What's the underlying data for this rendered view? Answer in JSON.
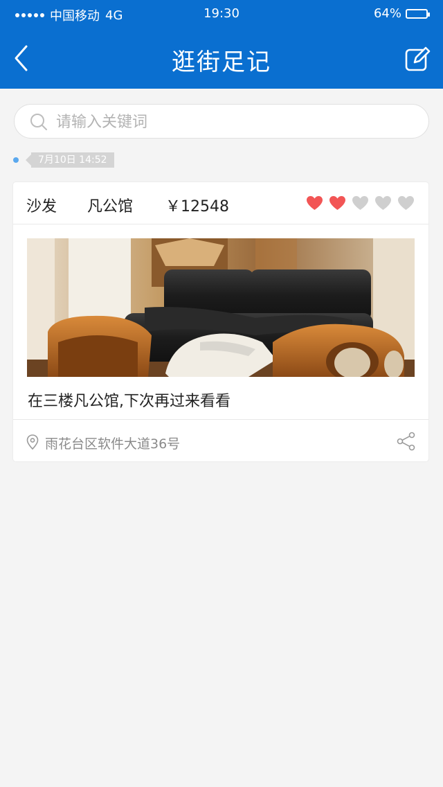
{
  "status_bar": {
    "carrier": "中国移动",
    "network": "4G",
    "time": "19:30",
    "battery": "64%",
    "battery_level": 0.64
  },
  "nav": {
    "title": "逛街足记",
    "back_icon": "chevron-left-icon",
    "edit_icon": "edit-icon"
  },
  "search": {
    "placeholder": "请输入关键词",
    "value": ""
  },
  "timeline": {
    "date": "7月10日  14:52"
  },
  "entry": {
    "category": "沙发",
    "shop": "凡公馆",
    "price": "￥12548",
    "rating": 2,
    "rating_max": 5,
    "rating_color": "#f25555",
    "rating_empty_color": "#cfcfcf",
    "note": "在三楼凡公馆,下次再过来看看",
    "location": "雨花台区软件大道36号",
    "share_icon": "share-icon"
  },
  "colors": {
    "accent": "#0a6fd0",
    "background": "#f4f4f4"
  }
}
